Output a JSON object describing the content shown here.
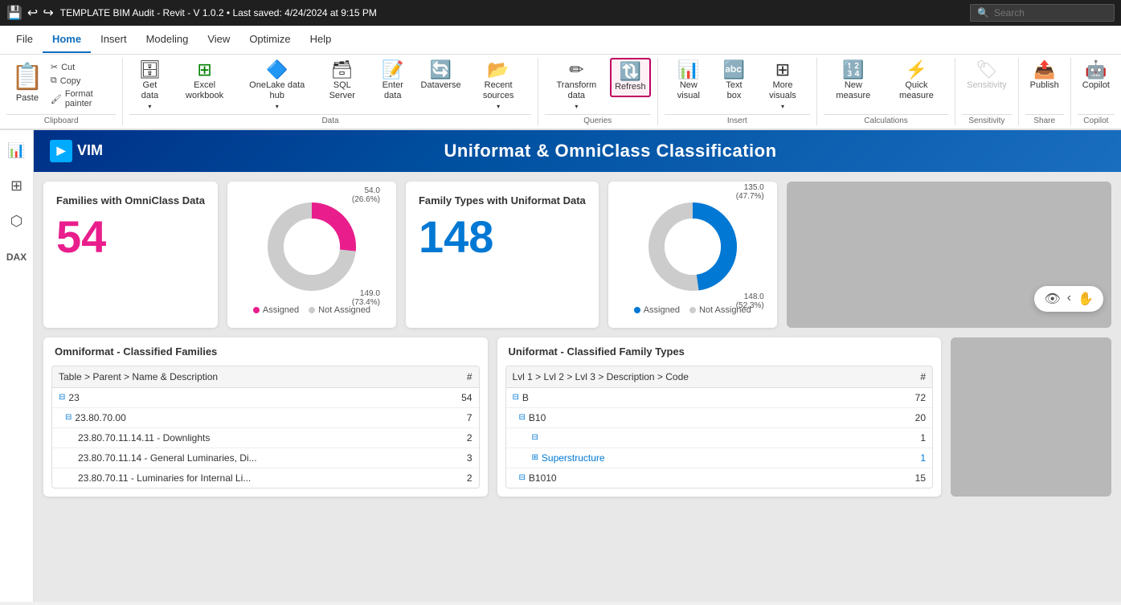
{
  "titleBar": {
    "title": "TEMPLATE BIM Audit - Revit - V 1.0.2 • Last saved: 4/24/2024 at 9:15 PM",
    "searchPlaceholder": "Search"
  },
  "ribbonTabs": [
    {
      "id": "file",
      "label": "File"
    },
    {
      "id": "home",
      "label": "Home",
      "active": true
    },
    {
      "id": "insert",
      "label": "Insert"
    },
    {
      "id": "modeling",
      "label": "Modeling"
    },
    {
      "id": "view",
      "label": "View"
    },
    {
      "id": "optimize",
      "label": "Optimize"
    },
    {
      "id": "help",
      "label": "Help"
    }
  ],
  "clipboard": {
    "groupLabel": "Clipboard",
    "pasteLabel": "Paste",
    "cutLabel": "Cut",
    "copyLabel": "Copy",
    "formatPainterLabel": "Format painter"
  },
  "dataGroup": {
    "label": "Data",
    "getDataLabel": "Get\ndata",
    "excelWorkbookLabel": "Excel\nworkbook",
    "oneLakeLabel": "OneLake\ndata hub",
    "sqlServerLabel": "SQL\nServer",
    "enterDataLabel": "Enter\ndata",
    "dataverseLabel": "Dataverse",
    "recentSourcesLabel": "Recent\nsources"
  },
  "queriesGroup": {
    "label": "Queries",
    "transformDataLabel": "Transform\ndata",
    "refreshLabel": "Refresh"
  },
  "insertGroup": {
    "label": "Insert",
    "newVisualLabel": "New\nvisual",
    "textBoxLabel": "Text\nbox",
    "moreVisualsLabel": "More\nvisuals"
  },
  "calculationsGroup": {
    "label": "Calculations",
    "newMeasureLabel": "New\nmeasure",
    "quickMeasureLabel": "Quick\nmeasure"
  },
  "sensitivityGroup": {
    "label": "Sensitivity",
    "sensitivityLabel": "Sensitivity"
  },
  "shareGroup": {
    "label": "Share",
    "publishLabel": "Publish"
  },
  "copilotGroup": {
    "label": "Copilot",
    "copilotLabel": "Copilot"
  },
  "sidebar": {
    "items": [
      {
        "id": "report",
        "icon": "📊",
        "label": "Report view"
      },
      {
        "id": "table",
        "icon": "⊞",
        "label": "Table view"
      },
      {
        "id": "model",
        "icon": "⊡",
        "label": "Model view"
      },
      {
        "id": "dax",
        "icon": "fx",
        "label": "DAX query view"
      }
    ]
  },
  "dashboard": {
    "logoText": "VIM",
    "title": "Uniformat & OmniClass Classification",
    "omniclassCard": {
      "title": "Families with OmniClass Data",
      "value": "54"
    },
    "omniclassDonut": {
      "assignedValue": "54.0",
      "assignedPct": "26.6%",
      "notAssignedValue": "149.0",
      "notAssignedPct": "73.4%",
      "assignedLabel": "Assigned",
      "notAssignedLabel": "Not Assigned"
    },
    "uniformatCard": {
      "title": "Family Types with Uniformat Data",
      "value": "148"
    },
    "uniformatDonut": {
      "assignedValue": "135.0",
      "assignedPct": "47.7%",
      "notAssignedValue": "148.0",
      "notAssignedPct": "52.3%",
      "assignedLabel": "Assigned",
      "notAssignedLabel": "Not Assigned"
    },
    "omniTable": {
      "title": "Omniformat - Classified Families",
      "colLabel": "Table > Parent > Name & Description",
      "colNum": "#",
      "rows": [
        {
          "indent": 0,
          "label": "23",
          "value": "54",
          "expandable": true
        },
        {
          "indent": 1,
          "label": "23.80.70.00",
          "value": "7",
          "expandable": true
        },
        {
          "indent": 2,
          "label": "23.80.70.11.14.11 - Downlights",
          "value": "2",
          "expandable": false
        },
        {
          "indent": 2,
          "label": "23.80.70.11.14 - General Luminaries, Di...",
          "value": "3",
          "expandable": false
        },
        {
          "indent": 2,
          "label": "23.80.70.11 - Luminaries for Internal Li...",
          "value": "2",
          "expandable": false
        }
      ]
    },
    "uniformatTable": {
      "title": "Uniformat - Classified Family Types",
      "colLabel": "Lvl 1 > Lvl 2 > Lvl 3 > Description > Code",
      "colNum": "#",
      "rows": [
        {
          "indent": 0,
          "label": "B",
          "value": "72",
          "expandable": true
        },
        {
          "indent": 1,
          "label": "B10",
          "value": "20",
          "expandable": true
        },
        {
          "indent": 2,
          "label": "",
          "value": "1",
          "expandable": true
        },
        {
          "indent": 2,
          "label": "Superstructure",
          "value": "1",
          "expandable": true,
          "linkStyle": true
        },
        {
          "indent": 1,
          "label": "B1010",
          "value": "15",
          "expandable": true
        }
      ]
    }
  }
}
